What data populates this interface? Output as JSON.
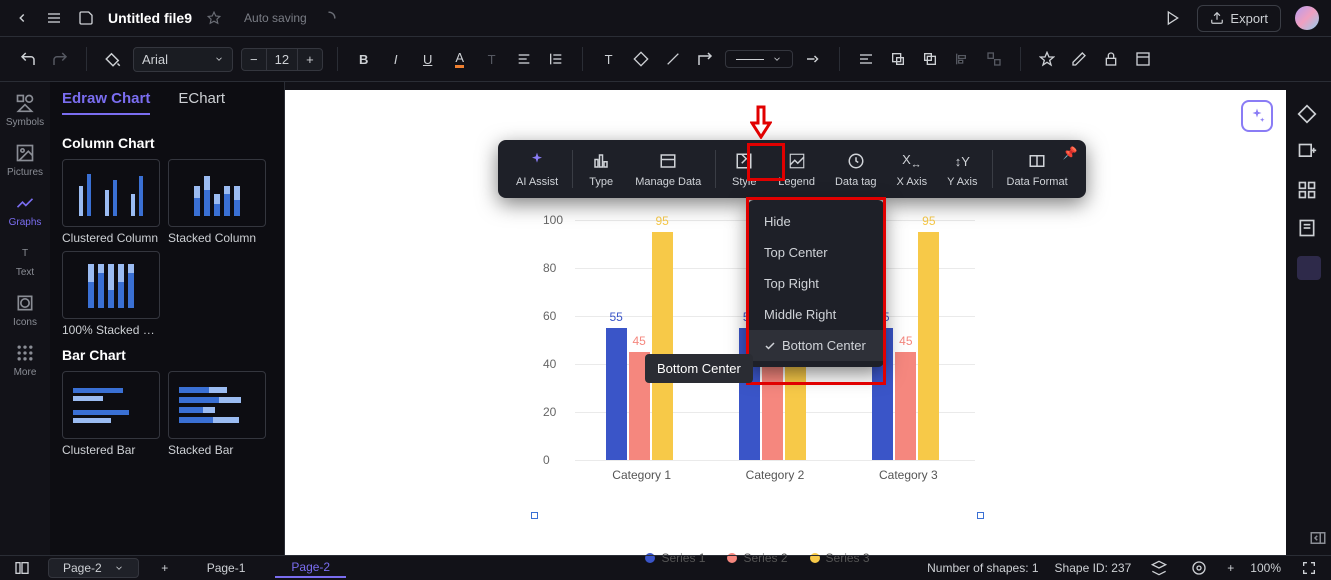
{
  "top_bar": {
    "file_title": "Untitled file9",
    "auto_save": "Auto saving",
    "export": "Export"
  },
  "toolbar": {
    "font": "Arial",
    "font_size": "12"
  },
  "left_rail": {
    "items": [
      "Symbols",
      "Pictures",
      "Graphs",
      "Text",
      "Icons",
      "More"
    ]
  },
  "side_panel": {
    "tabs": [
      "Edraw Chart",
      "EChart"
    ],
    "categories": [
      {
        "title": "Column Chart",
        "thumbs": [
          "Clustered Column",
          "Stacked Column",
          "100% Stacked C..."
        ]
      },
      {
        "title": "Bar Chart",
        "thumbs": [
          "Clustered Bar",
          "Stacked Bar"
        ]
      }
    ]
  },
  "float_toolbar": {
    "items": [
      "AI Assist",
      "Type",
      "Manage Data",
      "Style",
      "Legend",
      "Data tag",
      "X Axis",
      "Y Axis",
      "Data Format"
    ]
  },
  "dropdown": {
    "items": [
      "Hide",
      "Top Center",
      "Top Right",
      "Middle Right",
      "Bottom Center"
    ],
    "selected": "Bottom Center"
  },
  "tooltip": "Bottom Center",
  "status_bar": {
    "page_selector": "Page-2",
    "tabs": [
      "Page-1",
      "Page-2"
    ],
    "shapes_count": "Number of shapes: 1",
    "shape_id": "Shape ID: 237",
    "zoom": "100%"
  },
  "chart_data": {
    "type": "bar",
    "categories": [
      "Category 1",
      "Category 2",
      "Category 3"
    ],
    "series": [
      {
        "name": "Series 1",
        "color": "#3a55c8",
        "values": [
          55,
          55,
          55
        ]
      },
      {
        "name": "Series 2",
        "color": "#f5877e",
        "values": [
          45,
          45,
          45
        ]
      },
      {
        "name": "Series 3",
        "color": "#f7c948",
        "values": [
          95,
          95,
          95
        ]
      }
    ],
    "ylim": [
      0,
      100
    ],
    "y_ticks": [
      0,
      20,
      40,
      60,
      80,
      100
    ],
    "legend_position": "Bottom Center"
  }
}
